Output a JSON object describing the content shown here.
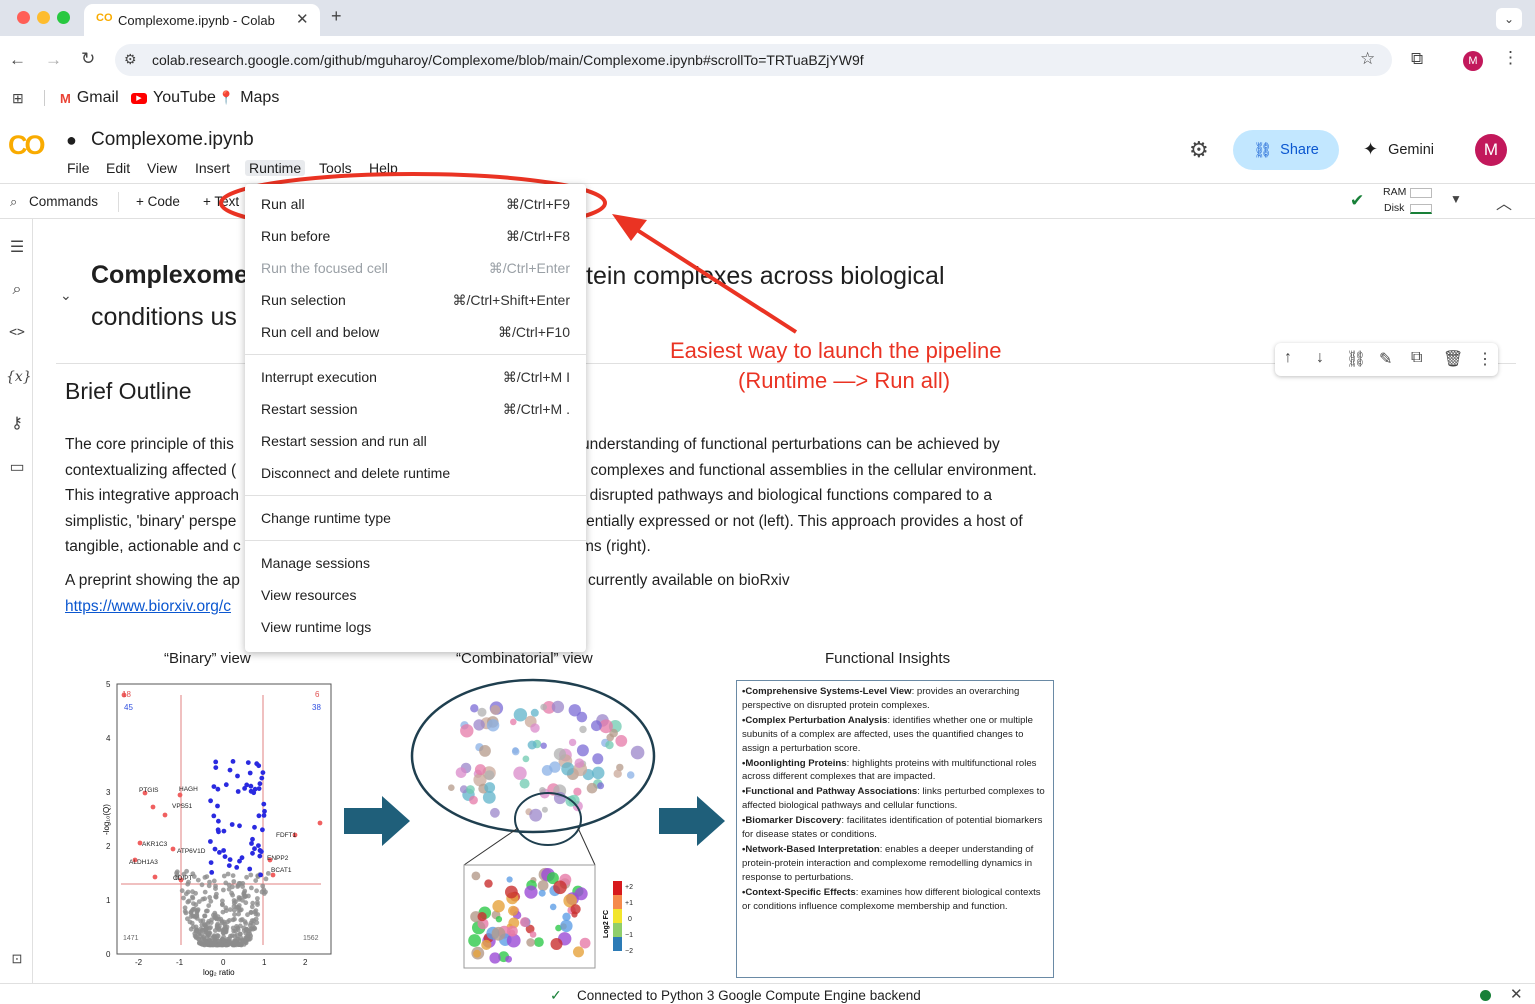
{
  "browser": {
    "tab_title": "Complexome.ipynb - Colab",
    "url": "colab.research.google.com/github/mguharoy/Complexome/blob/main/Complexome.ipynb#scrollTo=TRTuaBZjYW9f",
    "bookmarks": [
      "Gmail",
      "YouTube",
      "Maps"
    ],
    "profile_initial": "M"
  },
  "colab": {
    "logo": "CO",
    "notebook_title": "Complexome.ipynb",
    "menu": [
      "File",
      "Edit",
      "View",
      "Insert",
      "Runtime",
      "Tools",
      "Help"
    ],
    "share_label": "Share",
    "gemini_label": "Gemini",
    "avatar_initial": "M",
    "toolbar": {
      "commands": "Commands",
      "code": "+ Code",
      "text": "+ Text",
      "ram": "RAM",
      "disk": "Disk"
    },
    "status": "Connected to Python 3 Google Compute Engine backend"
  },
  "notebook": {
    "heading_part1": "Complexome",
    "heading_part2": "tein complexes across biological",
    "heading_line2": "conditions us",
    "section_title": "Brief Outline",
    "para_lines": [
      {
        "left": "The core principle of this",
        "right": "understanding of functional perturbations can be achieved by"
      },
      {
        "left": "contextualizing affected (",
        "right": "r complexes and functional assemblies in the cellular environment."
      },
      {
        "left": "This integrative approach",
        "right": "f disrupted pathways and biological functions compared to a"
      },
      {
        "left": "simplistic, 'binary' perspe",
        "right": "rentially expressed or not (left). This approach provides a host of"
      },
      {
        "left": "tangible, actionable and c",
        "right": "ms (right)."
      }
    ],
    "preprint_left": "A preprint showing the ap",
    "preprint_right": "currently available on bioRxiv",
    "link_text": "https://www.biorxiv.org/c"
  },
  "annotation": {
    "line1": "Easiest way to launch the pipeline",
    "line2": "(Runtime  —> Run all)"
  },
  "runtime_menu": [
    {
      "label": "Run all",
      "shortcut": "⌘/Ctrl+F9",
      "disabled": false
    },
    {
      "label": "Run before",
      "shortcut": "⌘/Ctrl+F8",
      "disabled": false
    },
    {
      "label": "Run the focused cell",
      "shortcut": "⌘/Ctrl+Enter",
      "disabled": true
    },
    {
      "label": "Run selection",
      "shortcut": "⌘/Ctrl+Shift+Enter",
      "disabled": false
    },
    {
      "label": "Run cell and below",
      "shortcut": "⌘/Ctrl+F10",
      "disabled": false
    },
    {
      "label": "Interrupt execution",
      "shortcut": "⌘/Ctrl+M I",
      "disabled": false
    },
    {
      "label": "Restart session",
      "shortcut": "⌘/Ctrl+M .",
      "disabled": false
    },
    {
      "label": "Restart session and run all",
      "shortcut": "",
      "disabled": false
    },
    {
      "label": "Disconnect and delete runtime",
      "shortcut": "",
      "disabled": false
    },
    {
      "label": "Change runtime type",
      "shortcut": "",
      "disabled": false
    },
    {
      "label": "Manage sessions",
      "shortcut": "",
      "disabled": false
    },
    {
      "label": "View resources",
      "shortcut": "",
      "disabled": false
    },
    {
      "label": "View runtime logs",
      "shortcut": "",
      "disabled": false
    }
  ],
  "figure": {
    "binary_title": "“Binary” view",
    "combinatorial_title": "“Combinatorial” view",
    "insights_title": "Functional Insights",
    "volcano": {
      "xlabel": "log₂ ratio",
      "ylabel": "-log₁₀(Q)",
      "xticks": [
        "-2",
        "-1",
        "0",
        "1",
        "2"
      ],
      "yticks": [
        "0",
        "1",
        "2",
        "3",
        "4",
        "5"
      ],
      "counts": {
        "top_left_red": "18",
        "top_left_blue": "45",
        "top_right_red": "6",
        "top_right_blue": "38",
        "bottom_left": "1471",
        "bottom_right": "1562"
      },
      "gene_labels": [
        "PTGIS",
        "HAGH",
        "VPS51",
        "AKR1C3",
        "ATP6V1D",
        "ALDH1A3",
        "CDIPT",
        "FDFT1",
        "ENPP2",
        "BCAT1"
      ]
    },
    "heatmap_label": "Log2 FC",
    "heatmap_ticks": [
      "+2",
      "+1",
      "0",
      "−1",
      "−2"
    ],
    "insights": [
      {
        "bold": "•Comprehensive Systems-Level View",
        "rest": ": provides an overarching perspective on disrupted protein complexes."
      },
      {
        "bold": "•Complex Perturbation Analysis",
        "rest": ": identifies whether one or multiple subunits of a complex are affected, uses the quantified changes to assign a perturbation score."
      },
      {
        "bold": "•Moonlighting Proteins",
        "rest": ": highlights proteins with multifunctional roles across different complexes that are impacted."
      },
      {
        "bold": "•Functional and Pathway Associations",
        "rest": ": links perturbed complexes to affected biological pathways and cellular functions."
      },
      {
        "bold": "•Biomarker Discovery",
        "rest": ": facilitates identification of potential biomarkers for disease states or conditions."
      },
      {
        "bold": "•Network-Based Interpretation",
        "rest": ": enables a deeper understanding of protein-protein interaction and complexome remodelling dynamics in response to perturbations."
      },
      {
        "bold": "•Context-Specific Effects",
        "rest": ": examines how different biological contexts or conditions influence complexome membership and function."
      }
    ]
  },
  "colors": {
    "accent": "#1a73e8",
    "orange": "#f9ab00",
    "annotation_red": "#ea3323",
    "arrow_teal": "#1f5f7a"
  }
}
